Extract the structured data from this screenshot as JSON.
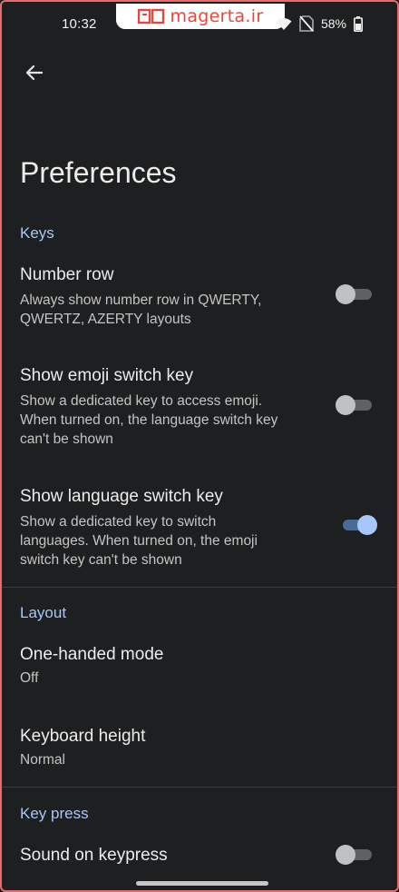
{
  "status_bar": {
    "time": "10:32",
    "battery": "58%",
    "watermark": "magerta.ir"
  },
  "page": {
    "title": "Preferences"
  },
  "sections": {
    "keys": {
      "header": "Keys",
      "number_row": {
        "title": "Number row",
        "summary": "Always show number row in QWERTY,\nQWERTZ, AZERTY layouts",
        "enabled": false
      },
      "emoji_switch": {
        "title": "Show emoji switch key",
        "summary": "Show a dedicated key to access emoji.\nWhen turned on, the language switch key\ncan't be shown",
        "enabled": false
      },
      "language_switch": {
        "title": "Show language switch key",
        "summary": "Show a dedicated key to switch\nlanguages. When turned on, the emoji\nswitch key can't be shown",
        "enabled": true
      }
    },
    "layout": {
      "header": "Layout",
      "one_handed": {
        "title": "One-handed mode",
        "value": "Off"
      },
      "keyboard_height": {
        "title": "Keyboard height",
        "value": "Normal"
      }
    },
    "key_press": {
      "header": "Key press",
      "sound_on_keypress": {
        "title": "Sound on keypress",
        "enabled": false
      }
    }
  },
  "colors": {
    "background": "#1e1f20",
    "accent": "#a8c7fa",
    "frame_border": "#e86a6a"
  },
  "icons": [
    "back-arrow-icon",
    "wifi-icon",
    "no-sim-icon",
    "battery-icon",
    "magerta-logo-icon"
  ]
}
